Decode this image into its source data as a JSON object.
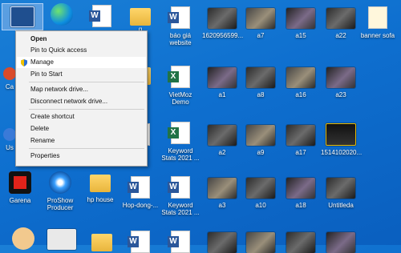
{
  "desktop": {
    "icons": [
      {
        "label": "",
        "kind": "thumb-blue"
      },
      {
        "label": "",
        "kind": "edge"
      },
      {
        "label": "",
        "kind": "word"
      },
      {
        "label": "g",
        "kind": "folder"
      },
      {
        "label": "báo giá website",
        "kind": "word"
      },
      {
        "label": "1620956599...",
        "kind": "thumb"
      },
      {
        "label": "a7",
        "kind": "thumb"
      },
      {
        "label": "a15",
        "kind": "thumb"
      },
      {
        "label": "a22",
        "kind": "thumb"
      },
      {
        "label": "banner sofa",
        "kind": "doc"
      },
      {
        "label": "Ca",
        "kind": "app"
      },
      {
        "label": "",
        "kind": "folder"
      },
      {
        "label": "VietMoz Demo",
        "kind": "excel"
      },
      {
        "label": "a1",
        "kind": "thumb"
      },
      {
        "label": "a8",
        "kind": "thumb"
      },
      {
        "label": "a16",
        "kind": "thumb"
      },
      {
        "label": "a23",
        "kind": "thumb"
      },
      {
        "label": "Us",
        "kind": "app"
      },
      {
        "label": "",
        "kind": "excel-plain"
      },
      {
        "label": "Keyword Stats 2021 ...",
        "kind": "excel"
      },
      {
        "label": "a2",
        "kind": "thumb"
      },
      {
        "label": "a9",
        "kind": "thumb"
      },
      {
        "label": "a17",
        "kind": "thumb"
      },
      {
        "label": "1514102020...",
        "kind": "thumb-dark"
      },
      {
        "label": "Garena",
        "kind": "garena"
      },
      {
        "label": "ProShow Producer",
        "kind": "proshow"
      },
      {
        "label": "hp house",
        "kind": "folder"
      },
      {
        "label": "Hop-dong-...",
        "kind": "word"
      },
      {
        "label": "Keyword Stats 2021 ...",
        "kind": "word"
      },
      {
        "label": "a3",
        "kind": "thumb"
      },
      {
        "label": "a10",
        "kind": "thumb"
      },
      {
        "label": "a18",
        "kind": "thumb"
      },
      {
        "label": "Untitleda",
        "kind": "thumb"
      }
    ]
  },
  "context_menu": {
    "items": [
      {
        "label": "Open",
        "bold": true
      },
      {
        "label": "Pin to Quick access"
      },
      {
        "label": "Manage",
        "shield": true,
        "highlighted": true
      },
      {
        "label": "Pin to Start"
      },
      {
        "label": "Map network drive..."
      },
      {
        "label": "Disconnect network drive..."
      },
      {
        "label": "Create shortcut"
      },
      {
        "label": "Delete"
      },
      {
        "label": "Rename"
      },
      {
        "label": "Properties"
      }
    ]
  }
}
